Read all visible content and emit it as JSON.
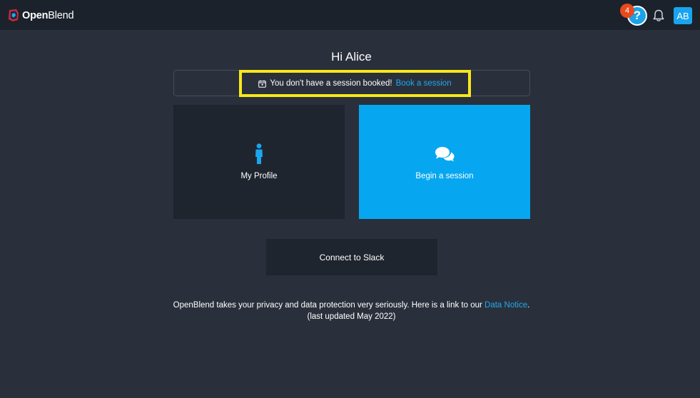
{
  "header": {
    "logo_bold": "Open",
    "logo_light": "Blend",
    "help_label": "?",
    "help_badge_count": "4",
    "avatar_initials": "AB"
  },
  "main": {
    "greeting": "Hi Alice",
    "notice": {
      "text": "You don't have a session booked!",
      "link_text": "Book a session"
    },
    "cards": {
      "profile_label": "My Profile",
      "session_label": "Begin a session"
    },
    "slack_label": "Connect to Slack",
    "privacy": {
      "text_before": "OpenBlend takes your privacy and data protection very seriously. Here is a link to our",
      "link_text": "Data Notice",
      "text_after": ".",
      "updated": "(last updated May 2022)"
    }
  },
  "colors": {
    "background": "#2a303b",
    "topbar": "#1c222c",
    "accent_blue": "#06a7f0",
    "highlight_yellow": "#f7e81a",
    "badge_orange": "#e8491e"
  },
  "icons": [
    "openblend-logo-icon",
    "help-icon",
    "bell-icon",
    "calendar-icon",
    "person-icon",
    "chat-bubbles-icon"
  ]
}
